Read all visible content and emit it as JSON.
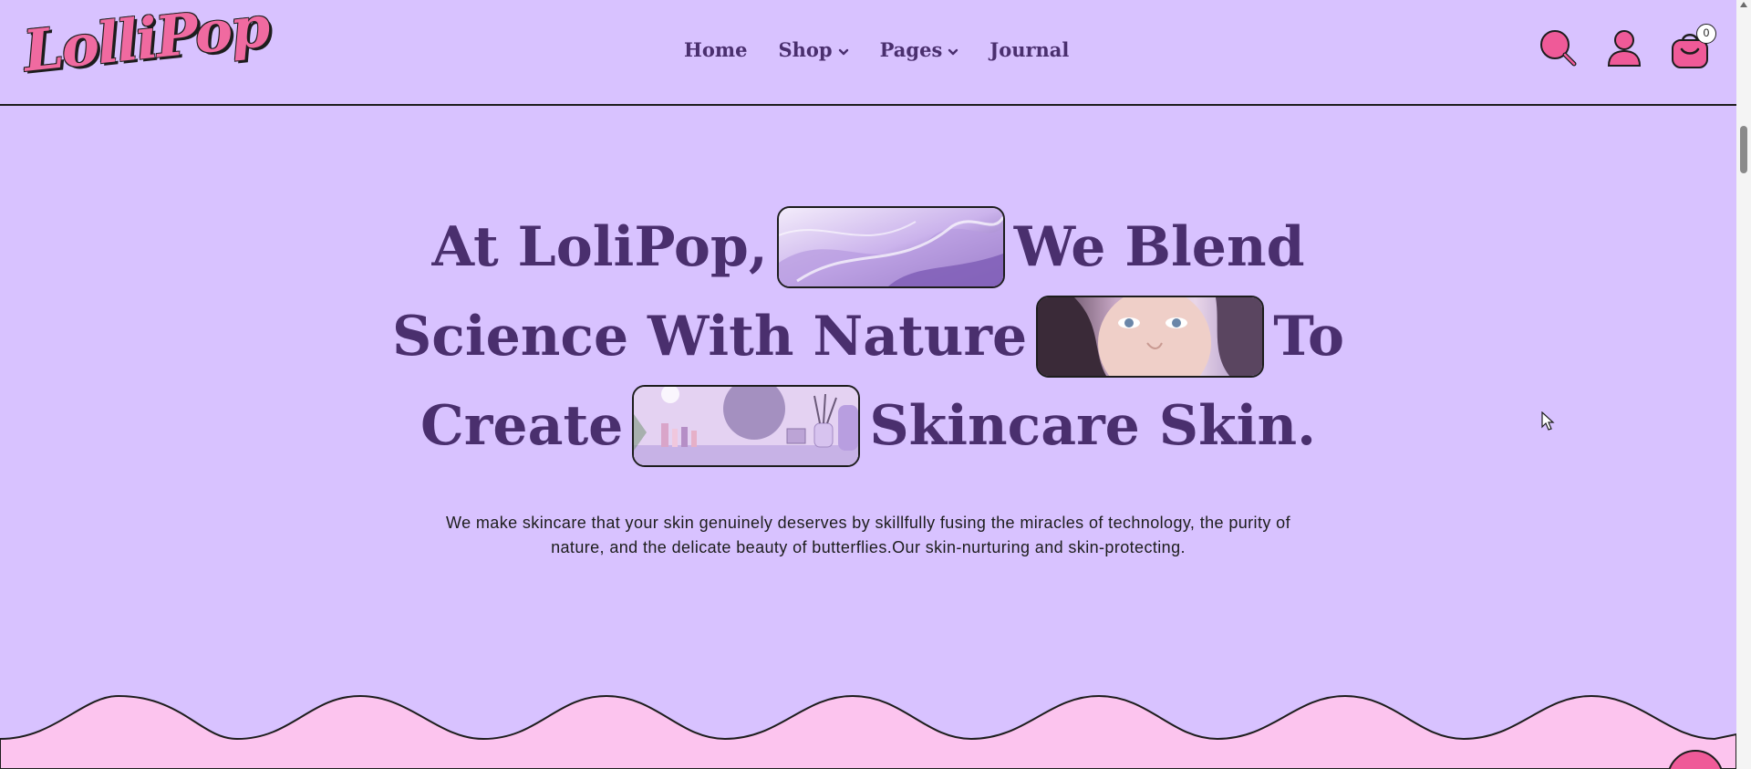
{
  "brand": {
    "logo_text": "LolliPop"
  },
  "nav": {
    "items": [
      {
        "label": "Home",
        "has_dropdown": false
      },
      {
        "label": "Shop",
        "has_dropdown": true
      },
      {
        "label": "Pages",
        "has_dropdown": true
      },
      {
        "label": "Journal",
        "has_dropdown": false
      }
    ]
  },
  "header_icons": {
    "search": "search-icon",
    "account": "user-icon",
    "cart": "cart-icon",
    "cart_count": "0"
  },
  "hero": {
    "line1": {
      "before": "At LoliPop,",
      "after": "We Blend"
    },
    "line2": {
      "before": "Science With Nature",
      "after": "To"
    },
    "line3": {
      "before": "Create",
      "after": "Skincare Skin."
    },
    "description": "We make skincare that your skin genuinely deserves by skillfully fusing the miracles of technology, the purity of nature, and the delicate beauty of butterflies.Our skin-nurturing and skin-protecting."
  },
  "colors": {
    "background": "#d8c2ff",
    "heading": "#4a2f6e",
    "accent_pink": "#ef5a98",
    "wave_pink": "#fcc4ee",
    "outline": "#1d1d1d"
  }
}
